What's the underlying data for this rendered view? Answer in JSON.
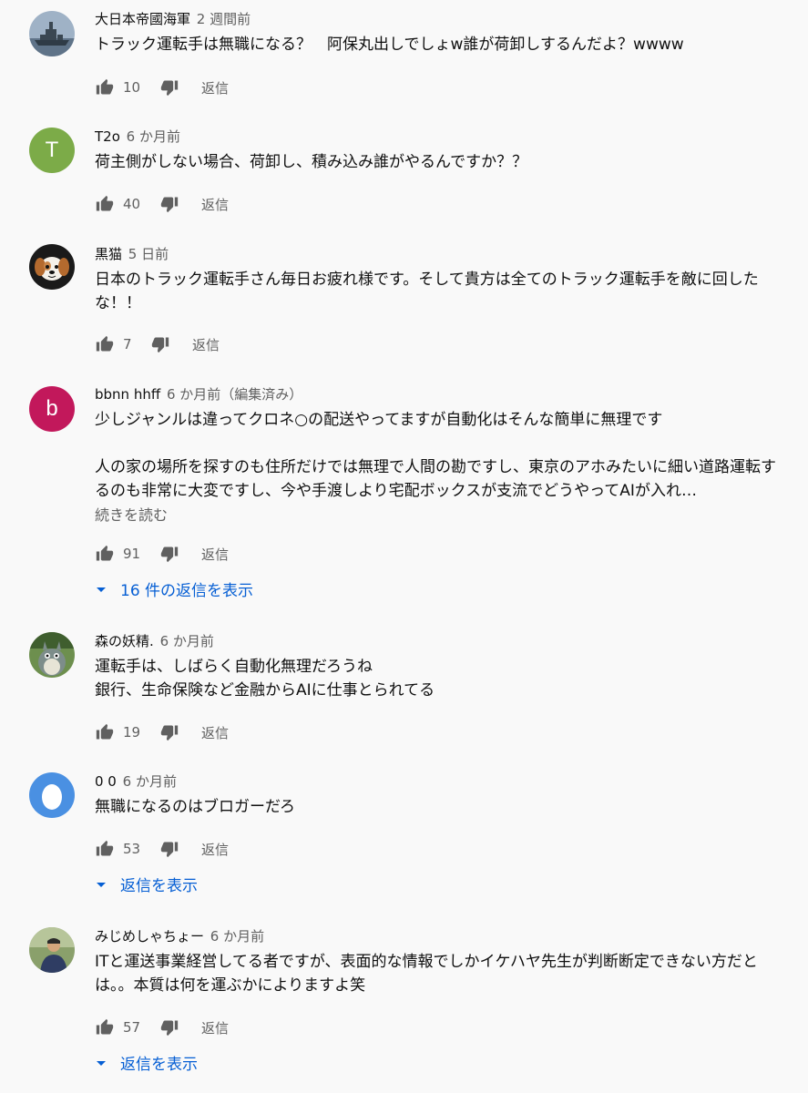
{
  "comments": [
    {
      "author": "大日本帝國海軍",
      "time": "2 週間前",
      "text": "トラック運転手は無職になる？　阿保丸出しでしょw誰が荷卸しするんだよ？wwww",
      "likes": "10",
      "reply_label": "返信",
      "avatar_kind": "battleship-photo-icon"
    },
    {
      "author": "T2o",
      "time": "6 か月前",
      "text": "荷主側がしない場合、荷卸し、積み込み誰がやるんですか？？",
      "likes": "40",
      "reply_label": "返信",
      "avatar_letter": "T",
      "avatar_color": "#7cab48"
    },
    {
      "author": "黒猫",
      "time": "5 日前",
      "text": "日本のトラック運転手さん毎日お疲れ様です。そして貴方は全てのトラック運転手を敵に回したな！！",
      "likes": "7",
      "reply_label": "返信",
      "avatar_kind": "dog-cartoon-icon"
    },
    {
      "author": "bbnn hhff",
      "time": "6 か月前",
      "edited": "（編集済み）",
      "text": "少しジャンルは違ってクロネ○の配送やってますが自動化はそんな簡単に無理です\n\n人の家の場所を探すのも住所だけでは無理で人間の勘ですし、東京のアホみたいに細い道路運転するのも非常に大変ですし、今や手渡しより宅配ボックスが支流でどうやってAIが入れ…",
      "read_more": "続きを読む",
      "likes": "91",
      "reply_label": "返信",
      "avatar_letter": "b",
      "avatar_color": "#c2185b",
      "show_replies": "16 件の返信を表示"
    },
    {
      "author": "森の妖精.",
      "time": "6 か月前",
      "text": "運転手は、しばらく自動化無理だろうね\n銀行、生命保険など金融からAIに仕事とられてる",
      "likes": "19",
      "reply_label": "返信",
      "avatar_kind": "forest-spirit-icon"
    },
    {
      "author": "0 0",
      "time": "6 か月前",
      "text": "無職になるのはブロガーだろ",
      "likes": "53",
      "reply_label": "返信",
      "avatar_kind": "egg-icon",
      "show_replies": "返信を表示"
    },
    {
      "author": "みじめしゃちょー",
      "time": "6 か月前",
      "text": "ITと運送事業経営してる者ですが、表面的な情報でしかイケハヤ先生が判断断定できない方だとは。。本質は何を運ぶかによりますよ笑",
      "likes": "57",
      "reply_label": "返信",
      "avatar_kind": "person-photo-icon",
      "show_replies": "返信を表示"
    }
  ],
  "colors": {
    "link": "#065fd4",
    "secondary_text": "#606060",
    "background": "#f9f9f9"
  }
}
